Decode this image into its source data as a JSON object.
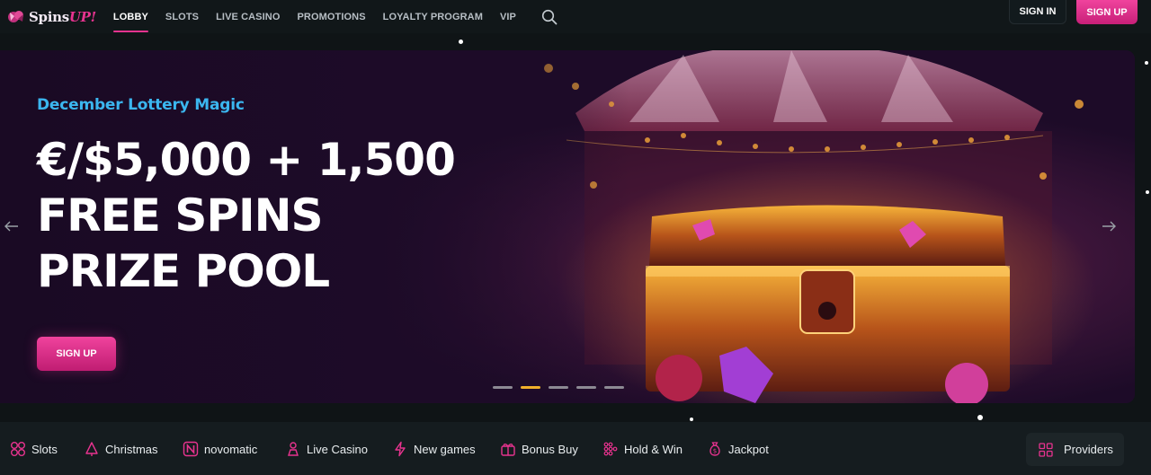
{
  "header": {
    "logo": {
      "text_main": "Spins",
      "text_accent": "UP!",
      "icon": "spinsup-logo-icon"
    },
    "nav": [
      {
        "label": "LOBBY",
        "active": true
      },
      {
        "label": "SLOTS",
        "active": false
      },
      {
        "label": "LIVE CASINO",
        "active": false
      },
      {
        "label": "PROMOTIONS",
        "active": false
      },
      {
        "label": "LOYALTY PROGRAM",
        "active": false
      },
      {
        "label": "VIP",
        "active": false
      }
    ],
    "search_icon": "search-icon",
    "sign_in_label": "SIGN IN",
    "sign_up_label": "SIGN UP"
  },
  "hero": {
    "eyebrow": "December Lottery Magic",
    "headline": [
      "€/$5,000 + 1,500",
      "FREE SPINS",
      "PRIZE POOL"
    ],
    "cta_label": "SIGN UP",
    "slides_total": 5,
    "active_slide": 2,
    "prev_icon": "arrow-left-icon",
    "next_icon": "arrow-right-icon"
  },
  "categories": [
    {
      "label": "Slots",
      "icon": "slots-icon"
    },
    {
      "label": "Christmas",
      "icon": "christmas-tree-icon"
    },
    {
      "label": "novomatic",
      "icon": "novomatic-icon"
    },
    {
      "label": "Live Casino",
      "icon": "live-casino-icon"
    },
    {
      "label": "New games",
      "icon": "lightning-icon"
    },
    {
      "label": "Bonus Buy",
      "icon": "gift-icon"
    },
    {
      "label": "Hold & Win",
      "icon": "grid-dots-icon"
    },
    {
      "label": "Jackpot",
      "icon": "money-bag-icon"
    }
  ],
  "providers_label": "Providers",
  "colors": {
    "accent": "#e8338f",
    "eyebrow": "#3bb6ef",
    "active_dot": "#f1b02b",
    "background": "#0f1416"
  }
}
